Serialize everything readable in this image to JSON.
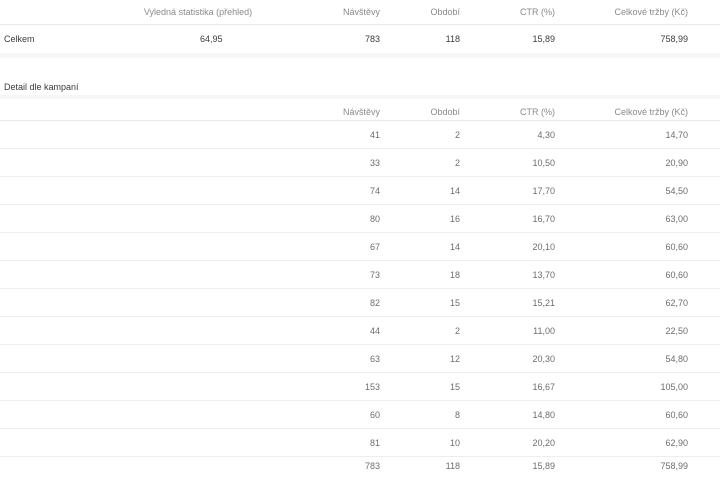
{
  "summary": {
    "headers": {
      "label": "Vyledná statistika (přehled)",
      "col1": "Návštěvy",
      "col2": "Období",
      "col3": "CTR (%)",
      "col4": "Celkové tržby (Kč)"
    },
    "row": {
      "name": "Celkem",
      "value": "64,95",
      "col1": "783",
      "col2": "118",
      "col3": "15,89",
      "col4": "758,99"
    }
  },
  "section": {
    "title": "Detail dle kampaní"
  },
  "table": {
    "headers": [
      "Návštěvy",
      "Období",
      "CTR (%)",
      "Celkové tržby (Kč)"
    ],
    "rows": [
      [
        "41",
        "2",
        "4,30",
        "14,70"
      ],
      [
        "33",
        "2",
        "10,50",
        "20,90"
      ],
      [
        "74",
        "14",
        "17,70",
        "54,50"
      ],
      [
        "80",
        "16",
        "16,70",
        "63,00"
      ],
      [
        "67",
        "14",
        "20,10",
        "60,60"
      ],
      [
        "73",
        "18",
        "13,70",
        "60,60"
      ],
      [
        "82",
        "15",
        "15,21",
        "62,70"
      ],
      [
        "44",
        "2",
        "11,00",
        "22,50"
      ],
      [
        "63",
        "12",
        "20,30",
        "54,80"
      ],
      [
        "153",
        "15",
        "16,67",
        "105,00"
      ],
      [
        "60",
        "8",
        "14,80",
        "60,60"
      ],
      [
        "81",
        "10",
        "20,20",
        "62,90"
      ]
    ],
    "total": [
      "783",
      "118",
      "15,89",
      "758,99"
    ]
  }
}
